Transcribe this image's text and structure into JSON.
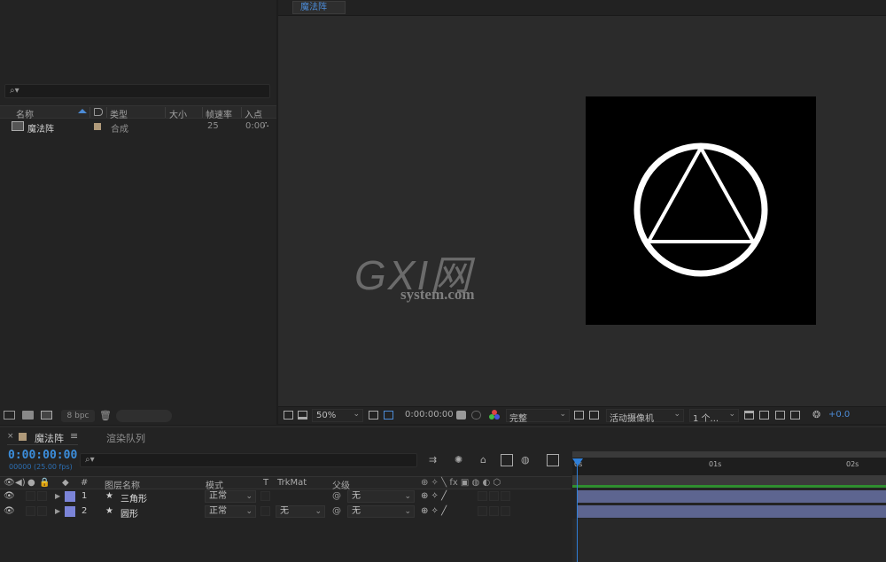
{
  "project": {
    "search_icon": "🔍",
    "columns": [
      "名称",
      "类型",
      "大小",
      "帧速率",
      "入点"
    ],
    "item": {
      "name": "魔法阵",
      "type": "合成",
      "fps": "25",
      "in": "0:00"
    },
    "bpc": "8 bpc"
  },
  "viewer": {
    "tab": "魔法阵",
    "zoom": "50%",
    "timecode": "0:00:00:00",
    "resolution": "完整",
    "camera": "活动摄像机",
    "views": "1 个...",
    "exposure": "+0.0",
    "watermark_top": "GXI网",
    "watermark_bottom": "system.com"
  },
  "timeline": {
    "comp_tab": "魔法阵",
    "render_tab": "渲染队列",
    "timecode": "0:00:00:00",
    "fps_text": "00000 (25.00 fps)",
    "headers": {
      "hash": "#",
      "layer_name": "图层名称",
      "mode": "模式",
      "t": "T",
      "trkmat": "TrkMat",
      "parent": "父级"
    },
    "layers": [
      {
        "num": "1",
        "name": "三角形",
        "mode": "正常",
        "trkmat": "",
        "parent": "无"
      },
      {
        "num": "2",
        "name": "圆形",
        "mode": "正常",
        "trkmat": "无",
        "parent": "无"
      }
    ],
    "ruler": [
      "0s",
      "01s",
      "02s"
    ],
    "accent": "#3c8edc",
    "layer_color": "#7b84d8",
    "track_color": "#5d6590"
  }
}
